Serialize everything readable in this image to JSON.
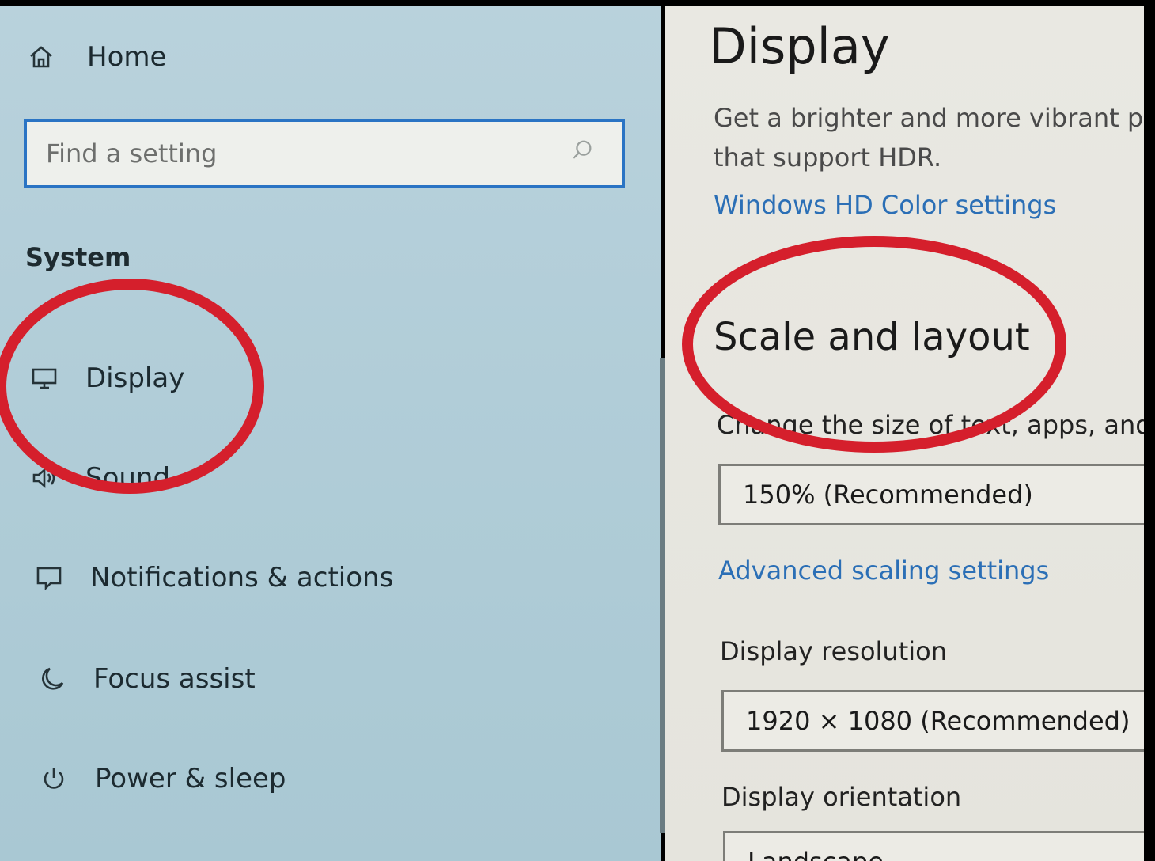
{
  "sidebar": {
    "home_label": "Home",
    "search_placeholder": "Find a setting",
    "section_label": "System",
    "items": [
      {
        "label": "Display",
        "icon": "monitor-icon"
      },
      {
        "label": "Sound",
        "icon": "speaker-icon"
      },
      {
        "label": "Notifications & actions",
        "icon": "notification-icon"
      },
      {
        "label": "Focus assist",
        "icon": "moon-icon"
      },
      {
        "label": "Power & sleep",
        "icon": "power-icon"
      }
    ]
  },
  "main": {
    "title": "Display",
    "hdr_description_line1": "Get a brighter and more vibrant p",
    "hdr_description_line2": "that support HDR.",
    "hdr_link": "Windows HD Color settings",
    "scale_heading": "Scale and layout",
    "scale_label": "Change the size of text, apps, and",
    "scale_value": "150% (Recommended)",
    "advanced_scaling_link": "Advanced scaling settings",
    "resolution_label": "Display resolution",
    "resolution_value": "1920 × 1080 (Recommended)",
    "orientation_label": "Display orientation",
    "orientation_value": "Landscape"
  },
  "colors": {
    "annotation": "#d51f2c",
    "link": "#2b6fb6",
    "search_border": "#2a74c4"
  }
}
